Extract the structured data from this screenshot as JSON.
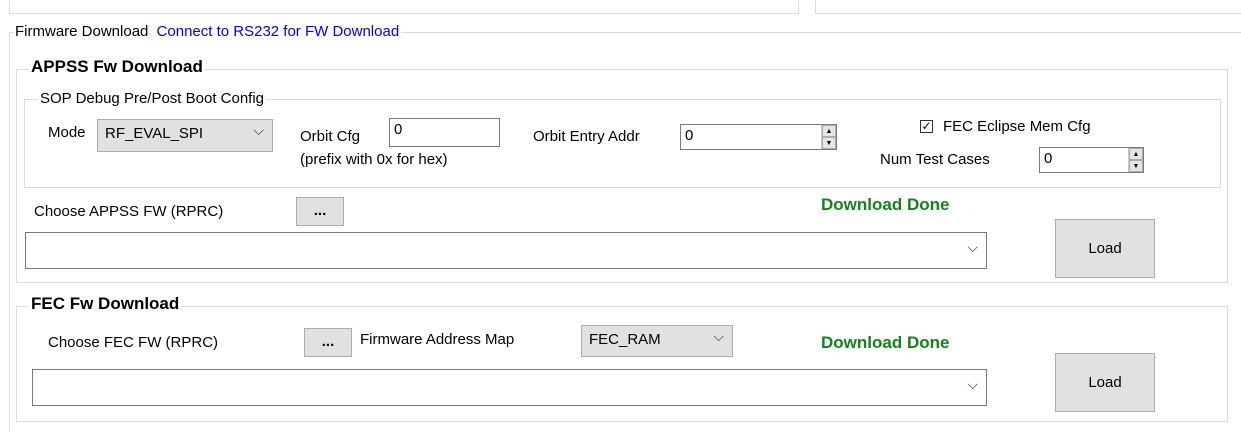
{
  "firmware_download": {
    "title": "Firmware Download",
    "rs232_link": "Connect to RS232 for FW Download"
  },
  "appss": {
    "title": "APPSS Fw Download",
    "sop_group": {
      "title": "SOP Debug Pre/Post Boot Config",
      "mode_label": "Mode",
      "mode_value": "RF_EVAL_SPI",
      "orbit_cfg_label": "Orbit Cfg",
      "orbit_cfg_value": "0",
      "orbit_cfg_hint": "(prefix with 0x for hex)",
      "orbit_entry_label": "Orbit Entry Addr",
      "orbit_entry_value": "0",
      "fec_eclipse_label": "FEC Eclipse Mem Cfg",
      "fec_eclipse_checked": true,
      "num_test_cases_label": "Num Test Cases",
      "num_test_cases_value": "0"
    },
    "choose_label": "Choose APPSS FW (RPRC)",
    "browse_label": "...",
    "status": "Download Done",
    "file_value": "",
    "load_label": "Load"
  },
  "fec": {
    "title": "FEC Fw Download",
    "choose_label": "Choose FEC FW (RPRC)",
    "browse_label": "...",
    "address_map_label": "Firmware Address Map",
    "address_map_value": "FEC_RAM",
    "status": "Download Done",
    "file_value": "",
    "load_label": "Load"
  },
  "icons": {
    "chevron": "chevron-down-icon",
    "checkmark": "checkmark-icon",
    "spin_up": "spin-up-icon",
    "spin_down": "spin-down-icon"
  },
  "colors": {
    "status_green": "#13841b",
    "link_blue": "#0000ff",
    "button_gray": "#e1e1e1"
  }
}
